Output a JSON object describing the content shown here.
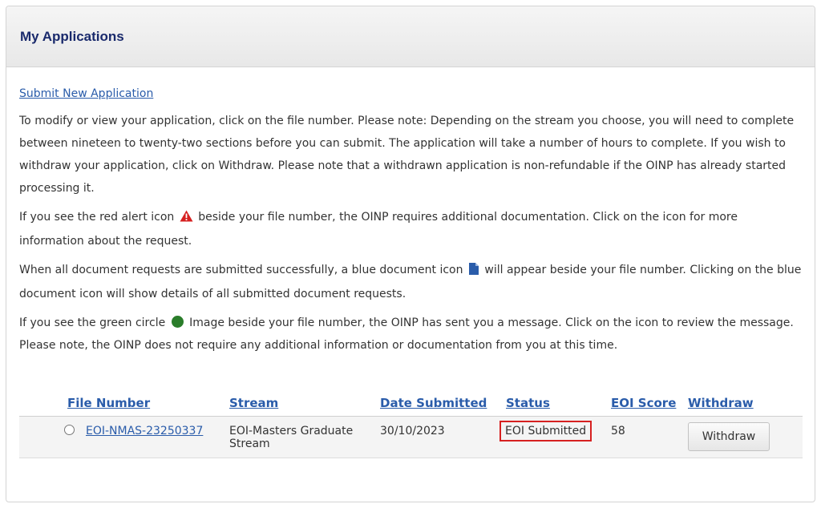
{
  "header": {
    "title": "My Applications"
  },
  "links": {
    "submit_new": "Submit New Application"
  },
  "instructions": {
    "p1": "To modify or view your application, click on the file number. Please note: Depending on the stream you choose, you will need to complete between nineteen to twenty-two sections before you can submit. The application will take a number of hours to complete. If you wish to withdraw your application, click on Withdraw. Please note that a withdrawn application is non-refundable if the OINP has already started processing it.",
    "p2_before": "If you see the red alert icon",
    "p2_after": "beside your file number, the OINP requires additional documentation. Click on the icon for more information about the request.",
    "p3_before": "When all document requests are submitted successfully, a blue document icon",
    "p3_after": "will appear beside your file number. Clicking on the blue document icon will show details of all submitted document requests.",
    "p4_before": "If you see the green circle",
    "p4_after": "Image beside your file number, the OINP has sent you a message. Click on the icon to review the message. Please note, the OINP does not require any additional information or documentation from you at this time."
  },
  "table": {
    "headers": {
      "file_number": "File Number",
      "stream": "Stream",
      "date_submitted": "Date Submitted",
      "status": "Status",
      "eoi_score": "EOI Score",
      "withdraw": "Withdraw"
    },
    "rows": [
      {
        "file_number": "EOI-NMAS-23250337",
        "stream": "EOI-Masters Graduate Stream",
        "date_submitted": "30/10/2023",
        "status": "EOI Submitted",
        "eoi_score": "58",
        "withdraw_label": "Withdraw"
      }
    ]
  },
  "colors": {
    "title": "#1a2a6c",
    "link": "#2a5caa",
    "alert_red": "#d62020",
    "doc_blue": "#2a5caa",
    "message_green": "#2a7d2a"
  },
  "icons": {
    "alert": "alert-triangle-icon",
    "document": "document-icon",
    "message": "green-circle-icon"
  }
}
